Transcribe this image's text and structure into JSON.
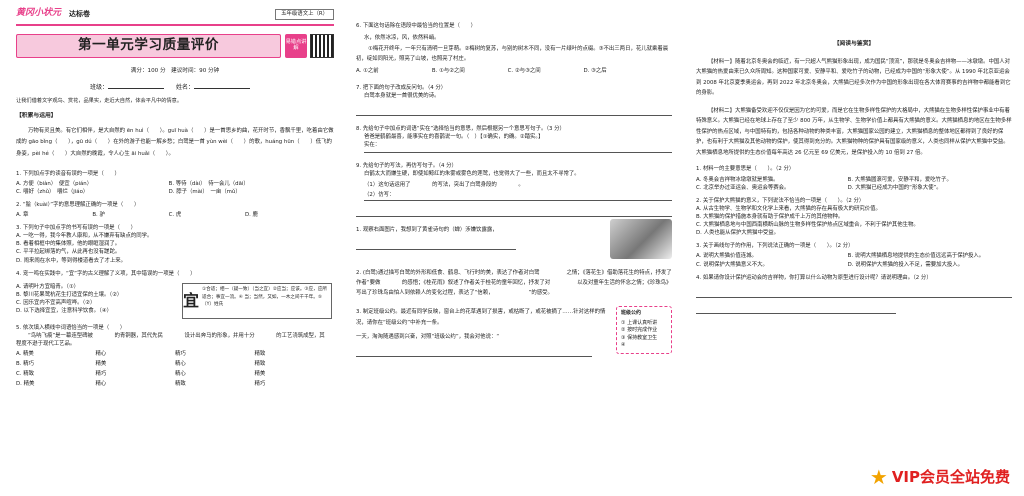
{
  "p1": {
    "logo": "黄冈小状元",
    "series": "达标卷",
    "grade": "五年级语文上（R）",
    "title": "第一单元学习质量评价",
    "qr_note": "易错点讲解",
    "meta": "满分：100 分　建议时间：90 分钟",
    "class_label": "班级：",
    "name_label": "姓名：",
    "note": "让我们借着文字观鸟、赏花，品果实，走近大自然，体会平凡中的情意。",
    "section1": "【积累与运用】",
    "para": "万物有灵且美。有它们相伴，是大自然的 ēn huì（　　）。guī huà（　　）是一首思乡的曲，花开时节，香飘千里，吃着由它做成的 gāo bǐng（　　），gū dú（　　）在外的游子也能一解乡愁；白鹭是一首 yùn wèi（　　）的歌，huáng hūn（　　）低飞的身姿，pèi hé（　　）大自然的晚霞，令人心生 āi huǎi（　　）。",
    "q1": "1. 下列加点字的读音有误的一项是（　　）",
    "q1_opts": [
      "A. 方便（biàn）　便宜（pián）",
      "B. 等待（dài）　待一会儿（dāi）",
      "C. 嚼好（zhǔ）　嚼烂（jiáo）",
      "D. 脖子（mài）　一亩（mǔ）"
    ],
    "q2": "2. “脍（kuài）”字的意思理解正确的一项是（　　）",
    "q2_opts": [
      "A. 章",
      "B. 驴",
      "C. 虎",
      "D. 鹿"
    ],
    "q3": "3. 下列句子中加点字的书写有误的一项是（　　）",
    "q3_opts": [
      "A. 一吃一得，我今年教人康和，从不嫌弃有缺点的同学。",
      "B. 看着相框中的集体照，他的眼眶湿润了。",
      "C. 平平拉起绑落的气，从此再也没有蹉跎。",
      "D. 闹来闹在水中，等到得楼道看去了才上来。"
    ],
    "q4": "4. 宠一鸣在实践中，“宜”字的古义理解了义项，其中错误的一项是（　　）",
    "q4_opts": [
      "A. 请明叶方宜暗青。（①）",
      "B. 黎川花果鹭杭花生打适宜保的土壤。（②）",
      "C. 因乐宜内不宜高声喧哗。（②）",
      "D. 以下选择宜宜，注意科学饮食。（④）"
    ],
    "hint_big": "宜",
    "hint_text": "①合适；相一（疑一致）（当之宜）②应当；应该。③应，应所适合；事宜一流。④ 当；当然，又如，一木之间千千年。⑤（Y）姓氏",
    "q5": "5. 依次填入横线中词语恰当的一项是（　　）",
    "q5_text": "“鸟呐飞痕”是一幕连型碑被　　　　的青铜器，其代先民　　　　设计出奔马的形象，并用十分　　　　的工艺浇筑成型，其　　　　程度不逊于现代工艺品。",
    "q5_opts": [
      [
        "A. 精美",
        "精心",
        "精巧",
        "精致"
      ],
      [
        "B. 精巧",
        "精美",
        "精心",
        "精致"
      ],
      [
        "C. 精致",
        "精巧",
        "精心",
        "精美"
      ],
      [
        "D. 精美",
        "精心",
        "精致",
        "精巧"
      ]
    ]
  },
  "p2": {
    "q6": "6. 下面这句话除在语段中最恰当的位置是（　　）",
    "q6_poem": "水，依然冰凉，风，依然料峭。",
    "q6_text": "①梅花开终年，一年只有清明一旦芽萌。②梅树的复苏，与别的树木不同，没有一片绿叶的点缀。③不出三两日，花儿就乘着晨初，绽如同阳光，照亮了山坡，也照亮了村庄。",
    "q6_opts": [
      "A. ①之前",
      "B. ①与②之间",
      "C. ②与③之间",
      "D. ③之后"
    ],
    "q7": "7. 把下面的句子改成反问句。（4 分）",
    "q7_text": "白鹭本身就是一首很优美的诗。",
    "q8": "8. 先给句子中加点的词语“实在”选择恰当的意思，然后根据另一个意思写句子。（3 分）",
    "q8_text": "爸爸是鹤鹤最喜，能事实在的喜鹊说一句。（　）【①确实，的确。②踏实。】",
    "q8_label": "实在：",
    "q9": "9. 先给句子的写法，再仿写句子。（4 分）",
    "q9_text": "白鹤太大而嫌生硬，即使如鲸红的朱雾或雾色的莲鹭，也觉得大了一些，而且太不寻常了。",
    "q9_sub1": "（1）这句话运用了　　　　的写法，突出了白鹭身段的　　　　。",
    "q9_sub2": "（2）仿写：",
    "q10": "1. 观察右面图片，我想到了黄雀诗句的（蝉）涉嫌饮露露，",
    "q11": "2. (白鹭)通过描写白鹭的外形和低食、鹤息、飞行时的美，表达了作者对白鹭　　　　　之情；《落花生》借助落花生的特点，抒发了作者“要做　　　　的感悟；《桂花雨》叙述了作者关于桂花的童年回忆，抒发了对　　　　　以及对童年生活的怀念之情；《珍珠鸟》写出了珍珠鸟由怕人到依赖人的变化过程，表达了“信赖，　　　　　　　”的感受。",
    "q12": "3. 制定班级公约。最近有同学反映，窗台上的花草遇到了损害，或枯断了，或花被摘了……针对这样的情况，请你在“班级公约”中补充一条。",
    "q12_b": "一天，淘淘随遇感到兴奋，对照“班级公约”，我会对他说：“",
    "tips_title": "班级公约",
    "tips_items": [
      "① 上课认真听讲",
      "② 按时完成作业",
      "③ 保持教室卫生",
      "④"
    ]
  },
  "p3": {
    "read_title": "【阅读与鉴赏】",
    "mat1": "【材料一】随着北京冬奥会的临近，有一只超人气熊猫形象出现，成为国民“顶流”，那就是冬奥会吉祥物——冰墩墩。中国人对大熊猫的热爱由来已久众所周知。这种国家可爱、安静平和、爱吃竹子的动物，已经成为中国的“形象大使”。从 1990 年北京亚运会到 2008 年北京夏季奥运会，再到 2022 年北京冬奥会，大熊猫已经多次作为中国的形象出现在各大体育赛事的吉祥物中都能看到它的身影。",
    "mat2": "【材料二】大熊猫备受欢迎不仅仅是因为它的可爱，而是它在生物多样性保护的大格局中，大熊猫在生物多样性保护事业中有着特殊意义。大熊猫已经在地球上存在了至少 800 万年，从生物学、生物学价值上都具有大熊猫的意义。大熊猫栖息的地区在生物多样性保护的热点区域，与中国特有的，包括各种动物的种类丰富，大熊猫国家公园的建立，大熊猫栖息的整体地区都得到了良好的保护，也有利于大熊猫及其他动物的保护，使其得到充分的。大熊猫物种的保护具有国家级的意义，人类也同样从保护大熊猫中受益。大熊猫栖息地所提供的生态价值每年高达 26 亿元至 69 亿美元，是保护投入的 10 倍到 27 倍。",
    "q1": "1. 材料一的主要意思是（　　）。（2 分）",
    "q1_opts": [
      "A. 冬奥会吉祥物冰墩墩就是熊猫。",
      "B. 大熊猫圆滚可爱，安静平和，爱吃竹子。",
      "C. 北京举办过亚运会、奥运会等赛会。",
      "D. 大熊猫已经成为中国的“形象大使”。"
    ],
    "q2": "2. 关于保护大熊猫的意义，下列说法不恰当的一项是（　　）。（2 分）",
    "q2_opts": [
      "A. 从古生物学、生物学和文化学上来看，大熊猫的存在具有极大的研究价值。",
      "B. 大熊猫的保护措施本身就有助于保护成千上万的其他物种。",
      "C. 大熊猫栖息地与中国西南横断山脉的生物多样性保护热点区域重合，不利于保护其他生物。",
      "D. 人类也能从保护大熊猫中受益。"
    ],
    "q3": "3. 关于画线句子的作用，下列说法正确的一项是（　　）。（2 分）",
    "q3_opts": [
      "A. 说明大熊猫价值连城。",
      "B. 说明大熊猫栖息地提供的生态价值远远高于保护投入。",
      "C. 说明保护大熊猫意义不大。",
      "D. 说明保护大熊猫的投入不足，需要加大投入。"
    ],
    "q4": "4. 如果请你设计保护运动会的吉祥物，你打算以什么动物为原型进行设计呢？请说明理由。（2 分）",
    "vip": "VIP会员全站免费"
  }
}
